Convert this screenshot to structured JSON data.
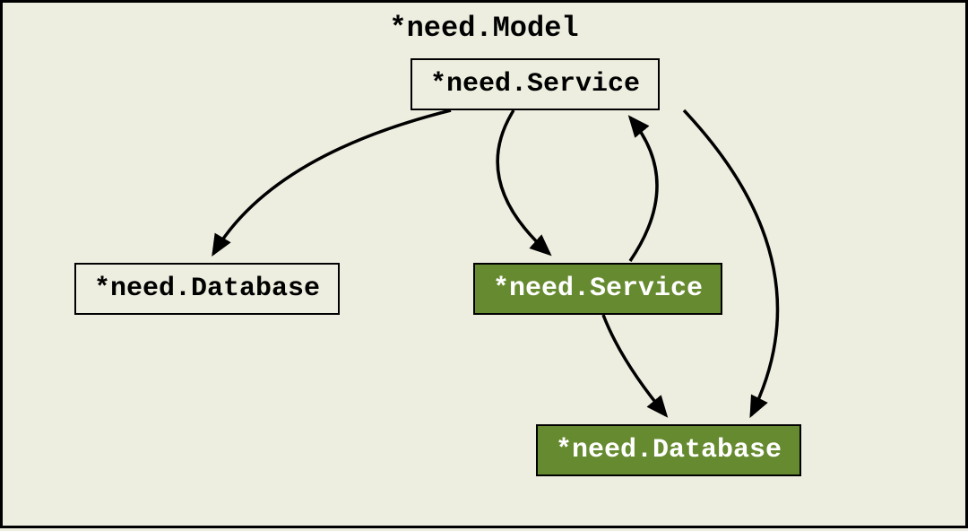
{
  "diagram": {
    "title": "*need.Model",
    "nodes": {
      "service_top": {
        "label": "*need.Service",
        "style": "white"
      },
      "database_left": {
        "label": "*need.Database",
        "style": "white"
      },
      "service_mid": {
        "label": "*need.Service",
        "style": "green"
      },
      "database_bottom": {
        "label": "*need.Database",
        "style": "green"
      }
    },
    "edges": [
      {
        "from": "service_top",
        "to": "database_left"
      },
      {
        "from": "service_top",
        "to": "service_mid"
      },
      {
        "from": "service_mid",
        "to": "service_top"
      },
      {
        "from": "service_top",
        "to": "database_bottom"
      },
      {
        "from": "service_mid",
        "to": "database_bottom"
      }
    ]
  }
}
